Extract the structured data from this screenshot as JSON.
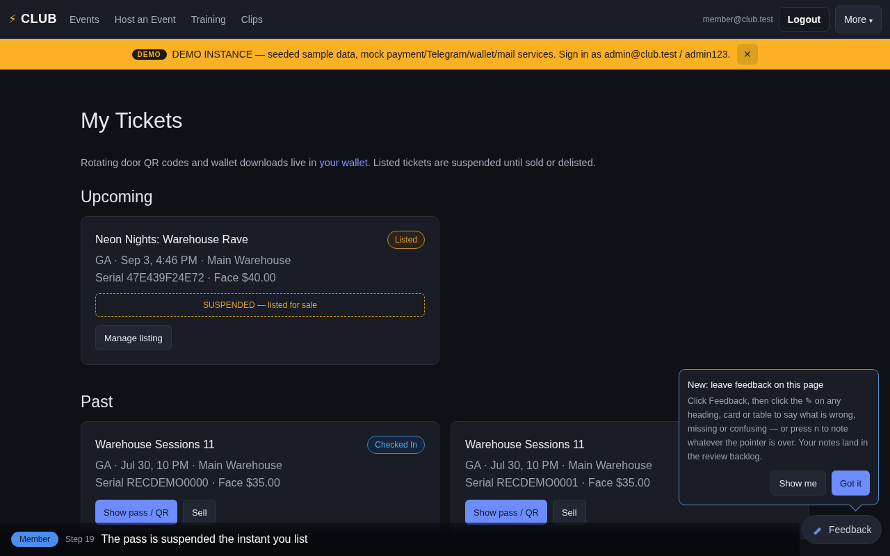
{
  "header": {
    "logo_icon": "⚡",
    "logo": "CLUB",
    "nav": [
      {
        "label": "Events"
      },
      {
        "label": "Host an Event"
      },
      {
        "label": "Training"
      },
      {
        "label": "Clips"
      }
    ],
    "user": "member@club.test",
    "logout": "Logout",
    "more": "More",
    "more_caret": "▾"
  },
  "banner": {
    "badge": "DEMO",
    "text": "DEMO INSTANCE — seeded sample data, mock payment/Telegram/wallet/mail services. Sign in as admin@club.test / admin123.",
    "close": "✕"
  },
  "title": "My Tickets",
  "intro": {
    "before": "Rotating door QR codes and wallet downloads live in ",
    "link": "your wallet",
    "after": ". Listed tickets are suspended until sold or delisted."
  },
  "sections": [
    {
      "heading": "Upcoming",
      "tickets": [
        {
          "name": "Neon Nights: Warehouse Rave",
          "badge": {
            "label": "Listed",
            "kind": "listed"
          },
          "line1": "GA · Sep 3, 4:46 PM · Main Warehouse",
          "line2": "Serial 47E439F24E72 · Face $40.00",
          "notice": "SUSPENDED — listed for sale",
          "buttons": [
            {
              "label": "Manage listing",
              "kind": "secondary"
            }
          ]
        }
      ]
    },
    {
      "heading": "Past",
      "tickets": [
        {
          "name": "Warehouse Sessions 11",
          "badge": {
            "label": "Checked In",
            "kind": "checked_in"
          },
          "line1": "GA · Jul 30, 10 PM · Main Warehouse",
          "line2": "Serial RECDEMO0000 · Face $35.00",
          "buttons": [
            {
              "label": "Show pass / QR",
              "kind": "primary"
            },
            {
              "label": "Sell",
              "kind": "secondary"
            }
          ]
        },
        {
          "name": "Warehouse Sessions 11",
          "line1": "GA · Jul 30, 10 PM · Main Warehouse",
          "line2": "Serial RECDEMO0001 · Face $35.00",
          "buttons": [
            {
              "label": "Show pass / QR",
              "kind": "primary"
            },
            {
              "label": "Sell",
              "kind": "secondary"
            }
          ]
        }
      ]
    }
  ],
  "popover": {
    "title": "New: leave feedback on this page",
    "body": "Click Feedback, then click the ✎ on any heading, card or table to say what is wrong, missing or confusing — or press n to note whatever the pointer is over. Your notes land in the review backlog.",
    "buttons": [
      {
        "label": "Show me",
        "kind": "secondary"
      },
      {
        "label": "Got it",
        "kind": "primary"
      }
    ]
  },
  "feedback_button": "Feedback",
  "caption": {
    "role": "Member",
    "step": "Step 19",
    "text": "The pass is suspended the instant you list"
  }
}
